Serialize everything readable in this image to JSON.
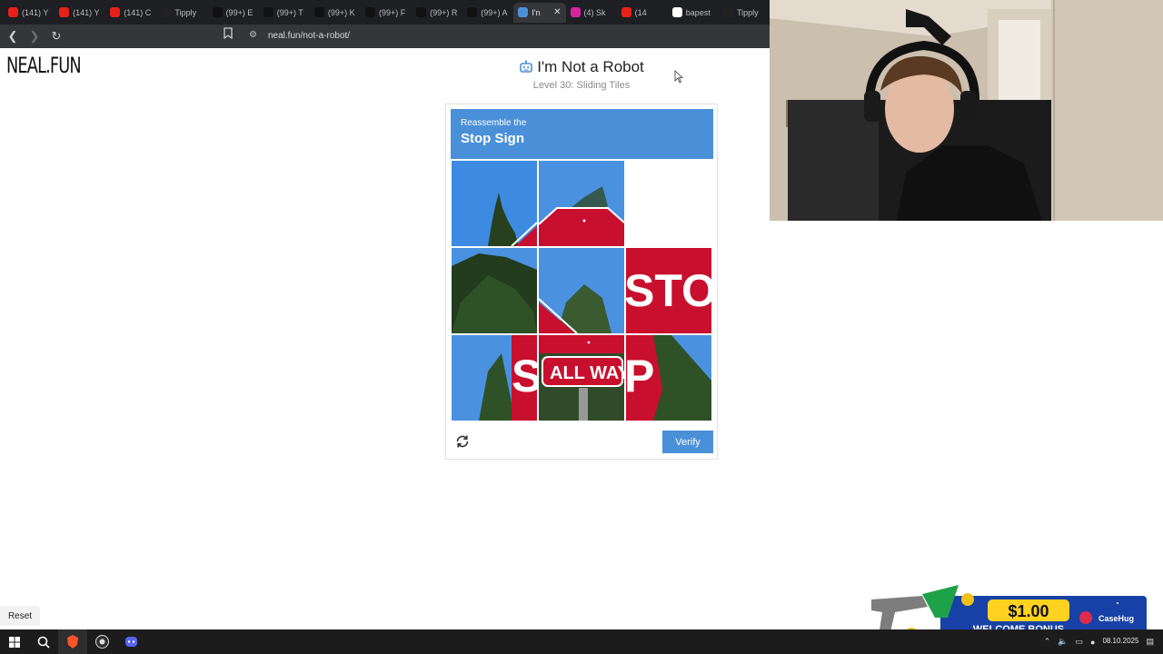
{
  "browser": {
    "tabs": [
      {
        "label": "(141) Y",
        "icon": "youtube-icon",
        "color": "#e62117"
      },
      {
        "label": "(141) Y",
        "icon": "youtube-icon",
        "color": "#e62117"
      },
      {
        "label": "(141) C",
        "icon": "youtube-icon",
        "color": "#e62117"
      },
      {
        "label": "Tipply",
        "icon": "tipply-icon",
        "color": "#222222"
      },
      {
        "label": "(99+) E",
        "icon": "tiktok-icon",
        "color": "#111111"
      },
      {
        "label": "(99+) T",
        "icon": "tiktok-icon",
        "color": "#111111"
      },
      {
        "label": "(99+) K",
        "icon": "tiktok-icon",
        "color": "#111111"
      },
      {
        "label": "(99+) F",
        "icon": "tiktok-icon",
        "color": "#111111"
      },
      {
        "label": "(99+) R",
        "icon": "tiktok-icon",
        "color": "#111111"
      },
      {
        "label": "(99+) A",
        "icon": "tiktok-icon",
        "color": "#111111"
      },
      {
        "label": "I'n",
        "icon": "robot-icon",
        "color": "#4a90d9",
        "active": true
      },
      {
        "label": "(4) Sk",
        "icon": "instagram-icon",
        "color": "#d6249f"
      },
      {
        "label": "(14",
        "icon": "youtube-icon",
        "color": "#e62117"
      },
      {
        "label": "bapest",
        "icon": "google-icon",
        "color": "#ffffff"
      },
      {
        "label": "Tipply",
        "icon": "tipply-icon",
        "color": "#222222"
      }
    ],
    "url": "neal.fun/not-a-robot/"
  },
  "page": {
    "logo": "NEAL.FUN",
    "title": "I'm Not a Robot",
    "level": "Level 30: Sliding Tiles"
  },
  "captcha": {
    "prompt_small": "Reassemble the",
    "prompt_big": "Stop Sign",
    "verify_label": "Verify",
    "accent": "#4a90d9"
  },
  "reset_label": "Reset",
  "ad": {
    "amount": "$1.00",
    "text": "WELCOME BONUS",
    "brand": "CaseHug"
  },
  "taskbar": {
    "date": "08.10.2025"
  }
}
